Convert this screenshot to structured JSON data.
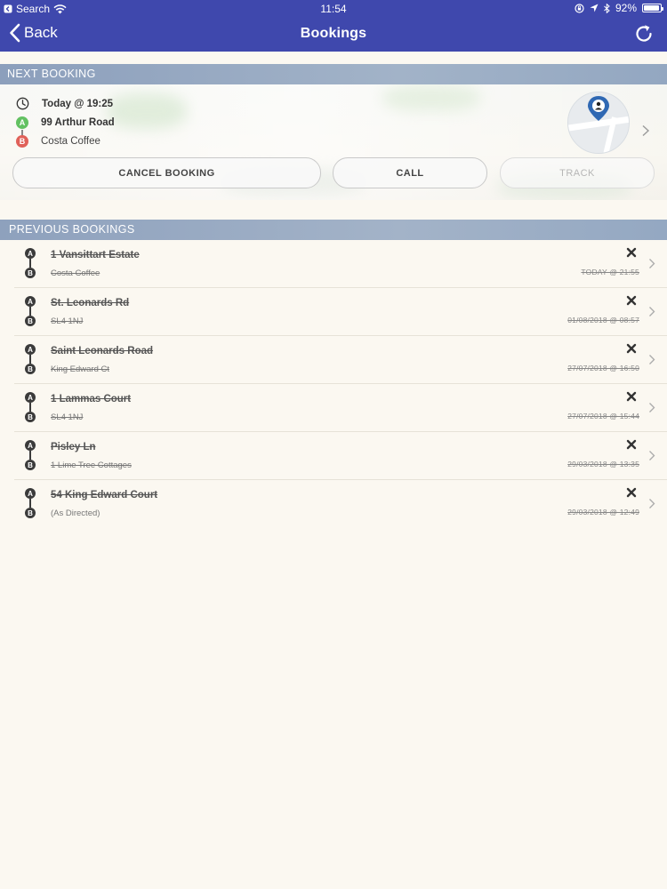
{
  "statusbar": {
    "back_app": "Search",
    "time": "11:54",
    "battery": "92%"
  },
  "navbar": {
    "back_label": "Back",
    "title": "Bookings"
  },
  "next_booking": {
    "header": "NEXT BOOKING",
    "time": "Today @ 19:25",
    "pickup_marker": "A",
    "pickup": "99 Arthur Road",
    "dropoff_marker": "B",
    "dropoff": "Costa Coffee",
    "buttons": {
      "cancel": "CANCEL BOOKING",
      "call": "CALL",
      "track": "TRACK"
    }
  },
  "previous_bookings": {
    "header": "PREVIOUS BOOKINGS",
    "marker_a": "A",
    "marker_b": "B",
    "items": [
      {
        "from": "1 Vansittart Estate",
        "to": "Costa Coffee",
        "date": "TODAY @ 21:55"
      },
      {
        "from": "St. Leonards Rd",
        "to": "SL4 1NJ",
        "date": "01/08/2018 @ 08:57"
      },
      {
        "from": "Saint Leonards Road",
        "to": "King Edward Ct",
        "date": "27/07/2018 @ 16:50"
      },
      {
        "from": "1 Lammas Court",
        "to": "SL4 1NJ",
        "date": "27/07/2018 @ 15:44"
      },
      {
        "from": "Pisley Ln",
        "to": "1 Lime Tree Cottages",
        "date": "29/03/2018 @ 13:35"
      },
      {
        "from": "54 King Edward Court",
        "to": "(As Directed)",
        "date": "29/03/2018 @ 12:49"
      }
    ]
  },
  "colors": {
    "nav_bg": "#3f48ad",
    "pickup_green": "#63c162",
    "dropoff_red": "#e06159",
    "section_header": "#9aabc4",
    "background": "#fbf8f1"
  },
  "icons": {
    "back": "chevron-left-icon",
    "refresh": "refresh-icon",
    "clock": "clock-icon",
    "delete": "close-icon",
    "disclosure": "chevron-right-icon",
    "map_pin": "map-pin-icon"
  }
}
